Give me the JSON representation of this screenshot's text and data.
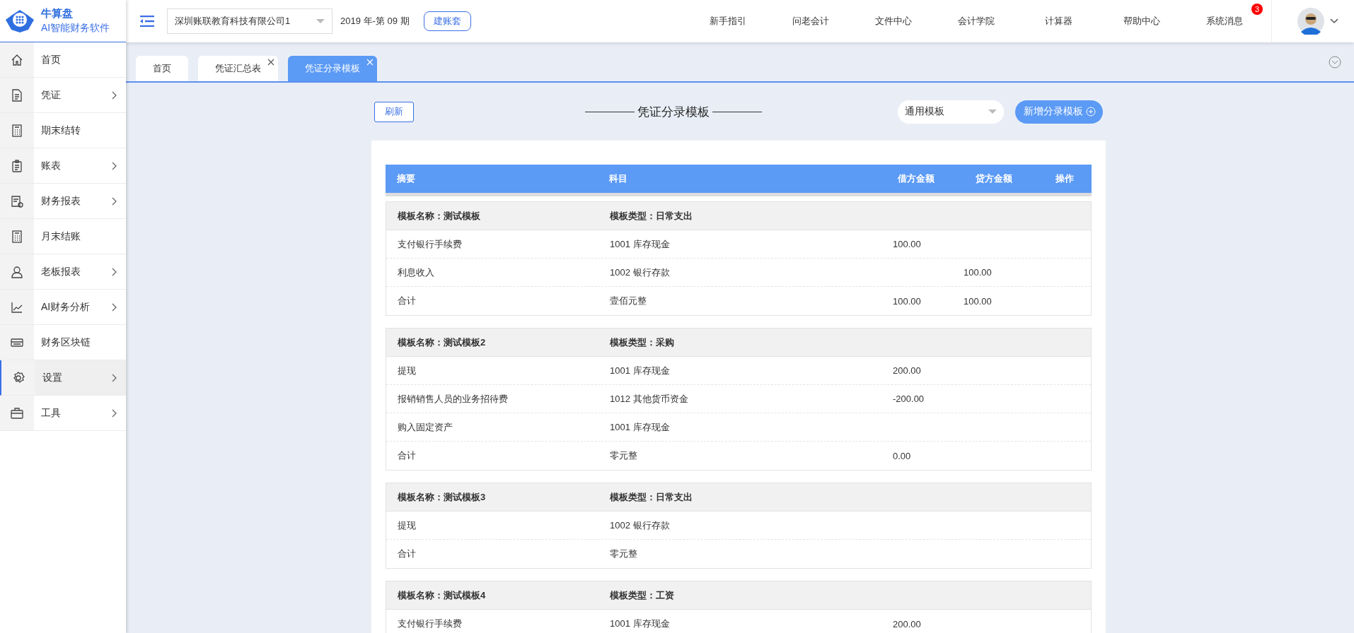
{
  "logo": {
    "title": "牛算盘",
    "subtitle": "AI智能财务软件"
  },
  "sidebar": {
    "items": [
      {
        "label": "首页",
        "kind": "home",
        "arrow": false,
        "selected": false
      },
      {
        "label": "凭证",
        "kind": "doc",
        "arrow": true,
        "selected": false
      },
      {
        "label": "期末结转",
        "kind": "calc",
        "arrow": false,
        "selected": false
      },
      {
        "label": "账表",
        "kind": "clipboard",
        "arrow": true,
        "selected": false
      },
      {
        "label": "财务报表",
        "kind": "report",
        "arrow": true,
        "selected": false
      },
      {
        "label": "月末结账",
        "kind": "calc",
        "arrow": false,
        "selected": false
      },
      {
        "label": "老板报表",
        "kind": "person",
        "arrow": true,
        "selected": false
      },
      {
        "label": "AI财务分析",
        "kind": "chart",
        "arrow": true,
        "selected": false
      },
      {
        "label": "财务区块链",
        "kind": "card",
        "arrow": false,
        "selected": false
      },
      {
        "label": "设置",
        "kind": "gear",
        "arrow": true,
        "selected": true
      },
      {
        "label": "工具",
        "kind": "briefcase",
        "arrow": true,
        "selected": false
      }
    ]
  },
  "topbar": {
    "company": "深圳账联教育科技有限公司1",
    "period": "2019 年-第 09 期",
    "create_button": "建账套",
    "links": [
      {
        "label": "新手指引"
      },
      {
        "label": "问老会计"
      },
      {
        "label": "文件中心"
      },
      {
        "label": "会计学院"
      },
      {
        "label": "计算器"
      },
      {
        "label": "帮助中心"
      },
      {
        "label": "系统消息",
        "badge": "3"
      }
    ]
  },
  "tabs": [
    {
      "label": "首页",
      "closable": false,
      "selected": false
    },
    {
      "label": "凭证汇总表",
      "closable": true,
      "selected": false
    },
    {
      "label": "凭证分录模板",
      "closable": true,
      "selected": true
    }
  ],
  "toolbar": {
    "refresh": "刷新",
    "title": "凭证分录模板",
    "filter": "通用模板",
    "add_button": "新增分录模板"
  },
  "table": {
    "columns": [
      "摘要",
      "科目",
      "借方金额",
      "贷方金额",
      "操作"
    ],
    "groups": [
      {
        "name": "模板名称：测试模板",
        "type": "模板类型：日常支出",
        "rows": [
          {
            "summary": "支付银行手续费",
            "account": "1001 库存现金",
            "debit": "100.00",
            "credit": ""
          },
          {
            "summary": "利息收入",
            "account": "1002 银行存款",
            "debit": "",
            "credit": "100.00"
          },
          {
            "summary": "合计",
            "account": "壹佰元整",
            "debit": "100.00",
            "credit": "100.00"
          }
        ]
      },
      {
        "name": "模板名称：测试模板2",
        "type": "模板类型：采购",
        "rows": [
          {
            "summary": "提现",
            "account": "1001 库存现金",
            "debit": "200.00",
            "credit": ""
          },
          {
            "summary": "报销销售人员的业务招待费",
            "account": "1012 其他货币资金",
            "debit": "-200.00",
            "credit": ""
          },
          {
            "summary": "购入固定资产",
            "account": "1001 库存现金",
            "debit": "",
            "credit": ""
          },
          {
            "summary": "合计",
            "account": "零元整",
            "debit": "0.00",
            "credit": ""
          }
        ]
      },
      {
        "name": "模板名称：测试模板3",
        "type": "模板类型：日常支出",
        "rows": [
          {
            "summary": "提现",
            "account": "1002 银行存款",
            "debit": "",
            "credit": ""
          },
          {
            "summary": "合计",
            "account": "零元整",
            "debit": "",
            "credit": ""
          }
        ]
      },
      {
        "name": "模板名称：测试模板4",
        "type": "模板类型：工资",
        "rows": [
          {
            "summary": "支付银行手续费",
            "account": "1001 库存现金",
            "debit": "200.00",
            "credit": ""
          }
        ]
      }
    ]
  }
}
